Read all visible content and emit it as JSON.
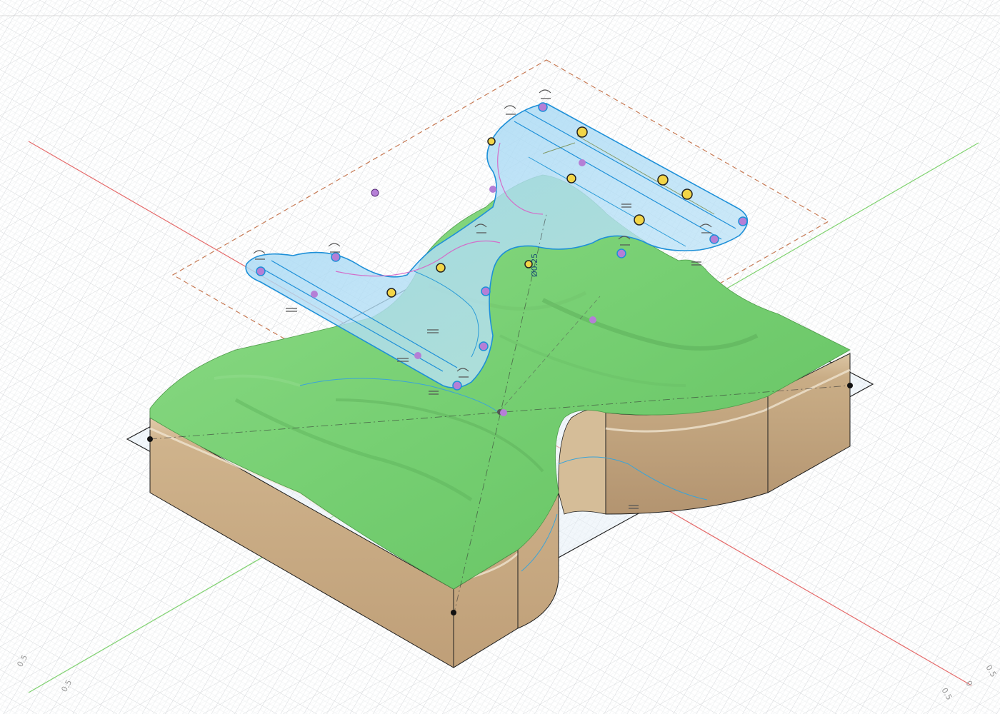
{
  "app": "3D CAD viewport",
  "colors": {
    "background": "#ffffff",
    "grid_major": "#cfd3d6",
    "grid_minor": "#e9ebec",
    "axis_x": "#e06a6a",
    "axis_y": "#7ccf6e",
    "terrain": "#7ed47a",
    "soil": "#cfb38c",
    "soil_dark": "#b89a72",
    "sketch": "#2b9ed8",
    "sketch_fill": "#a9d8f2",
    "sketch_point": "#b57fd6",
    "bounding_dash": "#c0704a"
  },
  "viewport": {
    "sketch_dimension": "Ø0.25",
    "grid_tick_labels": [
      "0.5",
      "0.5",
      "0",
      "0.5",
      "0.5"
    ]
  },
  "icons": [
    "sketch-constraint-icon",
    "sketch-point-icon",
    "origin-point-icon"
  ]
}
